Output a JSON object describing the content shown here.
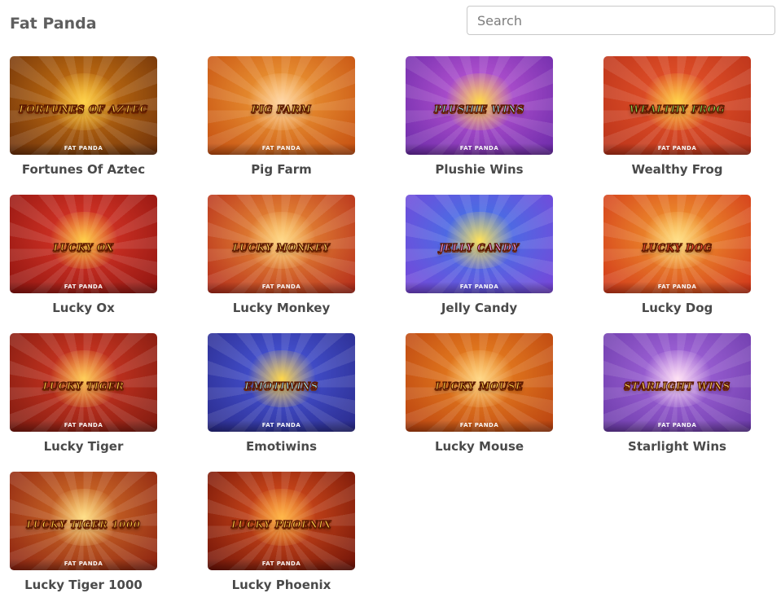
{
  "header": {
    "title": "Fat Panda",
    "search_placeholder": "Search"
  },
  "games": [
    {
      "name": "Fortunes Of Aztec",
      "logo": "FORTUNES OF AZTEC",
      "brand": "FAT PANDA",
      "bg": "#d27a12",
      "bg2": "#6b2f0a",
      "glow": "#ffd24a",
      "logo_color": "#ffd54a"
    },
    {
      "name": "Pig Farm",
      "logo": "PIG FARM",
      "brand": "FAT PANDA",
      "bg": "#f2a23a",
      "bg2": "#c44d10",
      "glow": "#ffd7a8",
      "logo_color": "#ffe45c"
    },
    {
      "name": "Plushie Wins",
      "logo": "PLUSHIE WINS",
      "brand": "FAT PANDA",
      "bg": "#c25ad8",
      "bg2": "#6a2aa8",
      "glow": "#ffd94a",
      "logo_color": "#8fe6ff"
    },
    {
      "name": "Wealthy Frog",
      "logo": "WEALTHY FROG",
      "brand": "FAT PANDA",
      "bg": "#e9552a",
      "bg2": "#b8321a",
      "glow": "#ffd24a",
      "logo_color": "#7ee25a"
    },
    {
      "name": "Lucky Ox",
      "logo": "LUCKY OX",
      "brand": "FAT PANDA",
      "bg": "#e23a2a",
      "bg2": "#8e1410",
      "glow": "#ffcf4a",
      "logo_color": "#ffd54a"
    },
    {
      "name": "Lucky Monkey",
      "logo": "LUCKY MONKEY",
      "brand": "FAT PANDA",
      "bg": "#f09a3a",
      "bg2": "#b2281a",
      "glow": "#ffd98a",
      "logo_color": "#ffe066"
    },
    {
      "name": "Jelly Candy",
      "logo": "JELLY CANDY",
      "brand": "FAT PANDA",
      "bg": "#3a7ae8",
      "bg2": "#7a44d8",
      "glow": "#ffe25a",
      "logo_color": "#f4a2ff"
    },
    {
      "name": "Lucky Dog",
      "logo": "LUCKY DOG",
      "brand": "FAT PANDA",
      "bg": "#f4a030",
      "bg2": "#d0341a",
      "glow": "#ffe08a",
      "logo_color": "#ff5a3a"
    },
    {
      "name": "Lucky Tiger",
      "logo": "LUCKY TIGER",
      "brand": "FAT PANDA",
      "bg": "#d93a24",
      "bg2": "#7e1a10",
      "glow": "#ffcf5a",
      "logo_color": "#ffd54a"
    },
    {
      "name": "Emotiwins",
      "logo": "EMOTIWINS",
      "brand": "FAT PANDA",
      "bg": "#4a5ae0",
      "bg2": "#2a2a8a",
      "glow": "#ffd84a",
      "logo_color": "#9bf0ff"
    },
    {
      "name": "Lucky Mouse",
      "logo": "LUCKY MOUSE",
      "brand": "FAT PANDA",
      "bg": "#ef8a22",
      "bg2": "#b84010",
      "glow": "#ffd98a",
      "logo_color": "#ffd54a"
    },
    {
      "name": "Starlight Wins",
      "logo": "STARLIGHT WINS",
      "brand": "FAT PANDA",
      "bg": "#a96ae0",
      "bg2": "#6a3aa8",
      "glow": "#ffe2f4",
      "logo_color": "#ffd96a"
    },
    {
      "name": "Lucky Tiger 1000",
      "logo": "LUCKY TIGER 1000",
      "brand": "FAT PANDA",
      "bg": "#d8762a",
      "bg2": "#8a2010",
      "glow": "#ffe08a",
      "logo_color": "#ffd54a"
    },
    {
      "name": "Lucky Phoenix",
      "logo": "LUCKY PHOENIX",
      "brand": "FAT PANDA",
      "bg": "#e2541e",
      "bg2": "#6e1208",
      "glow": "#ffb84a",
      "logo_color": "#ffd54a"
    }
  ]
}
